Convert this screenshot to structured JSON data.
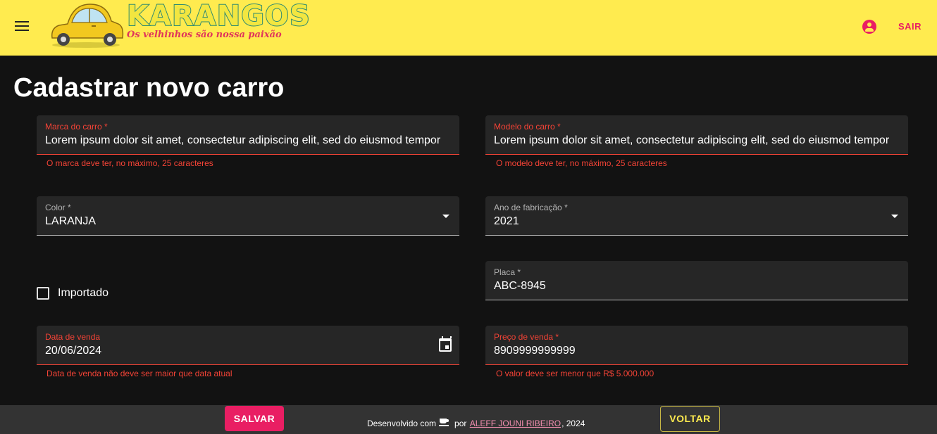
{
  "header": {
    "brand_title": "KARANGOS",
    "brand_subtitle": "Os velhinhos são nossa paixão",
    "logout_label": "SAIR"
  },
  "page": {
    "title": "Cadastrar novo carro"
  },
  "form": {
    "brand": {
      "label": "Marca do carro *",
      "value": "Lorem ipsum dolor sit amet, consectetur adipiscing elit, sed do eiusmod tempor",
      "error": "O marca deve ter, no máximo, 25 caracteres"
    },
    "model": {
      "label": "Modelo do carro *",
      "value": "Lorem ipsum dolor sit amet, consectetur adipiscing elit, sed do eiusmod tempor",
      "error": "O modelo deve ter, no máximo, 25 caracteres"
    },
    "color": {
      "label": "Color *",
      "value": "LARANJA"
    },
    "year": {
      "label": "Ano de fabricação *",
      "value": "2021"
    },
    "plate": {
      "label": "Placa *",
      "value": "ABC-8945"
    },
    "imported": {
      "label": "Importado",
      "checked": false
    },
    "sale_date": {
      "label": "Data de venda",
      "value": "20/06/2024",
      "error": "Data de venda não deve ser maior que data atual"
    },
    "price": {
      "label": "Preço de venda *",
      "value": "8909999999999",
      "error": "O valor deve ser menor que R$ 5.000.000"
    }
  },
  "footer": {
    "save_label": "SALVAR",
    "back_label": "VOLTAR",
    "credits_prefix": "Desenvolvido com",
    "credits_by": "por",
    "author": "ALEFF JOUNI RIBEIRO",
    "credits_suffix": ", 2024"
  },
  "colors": {
    "appbar": "#ffeb4f",
    "background": "#121212",
    "field_bg": "#262626",
    "error": "#f44336",
    "primary": "#e91e63"
  }
}
